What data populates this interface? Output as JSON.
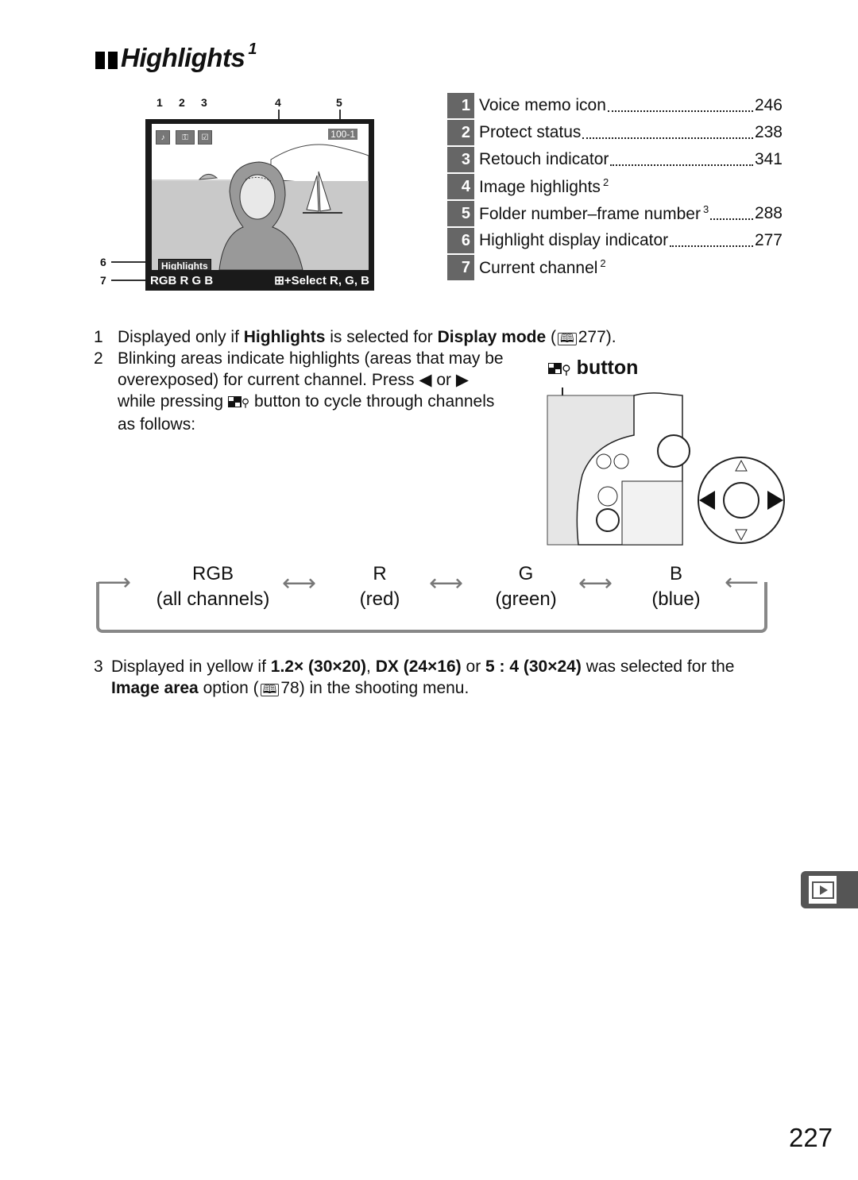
{
  "title": {
    "text": "Highlights",
    "superscript": "1"
  },
  "screen": {
    "callouts": [
      "1",
      "2",
      "3",
      "4",
      "5",
      "6",
      "7"
    ],
    "folder_frame": "100-1",
    "highlight_label": "Highlights",
    "channel_readout": "RGB R G B",
    "hint": "+Select R, G, B"
  },
  "legend": [
    {
      "num": "1",
      "label": "Voice memo icon",
      "sup": "",
      "page": "246"
    },
    {
      "num": "2",
      "label": "Protect status",
      "sup": "",
      "page": "238"
    },
    {
      "num": "3",
      "label": "Retouch indicator",
      "sup": "",
      "page": "341"
    },
    {
      "num": "4",
      "label": "Image highlights",
      "sup": "2",
      "page": ""
    },
    {
      "num": "5",
      "label": "Folder number–frame number",
      "sup": "3",
      "page": "288"
    },
    {
      "num": "6",
      "label": "Highlight display indicator",
      "sup": "",
      "page": "277"
    },
    {
      "num": "7",
      "label": "Current channel",
      "sup": "2",
      "page": ""
    }
  ],
  "notes": {
    "n1": {
      "num": "1",
      "pre": "Displayed only if ",
      "b1": "Highlights",
      "mid": " is selected for ",
      "b2": "Display mode",
      "ref": "(",
      "page": "277",
      "post": ")."
    },
    "n2": {
      "num": "2",
      "line1": "Blinking areas indicate highlights (areas that may be",
      "line2": "overexposed) for current channel.  Press ◀ or ▶",
      "line3a": "while pressing ",
      "line3b": " button to cycle through channels",
      "line4": "as follows:"
    },
    "n3": {
      "num": "3",
      "pre": "Displayed in yellow if ",
      "b1": "1.2× (30×20)",
      "sep1": ", ",
      "b2": "DX (24×16)",
      "sep2": " or ",
      "b3": "5 : 4 (30×24)",
      "post": " was selected for the",
      "b4": "Image area",
      "post2": " option (",
      "page": "78",
      "post3": ") in the shooting menu."
    }
  },
  "button_caption": "button",
  "cycle": [
    {
      "name": "RGB",
      "desc": "(all channels)"
    },
    {
      "name": "R",
      "desc": "(red)"
    },
    {
      "name": "G",
      "desc": "(green)"
    },
    {
      "name": "B",
      "desc": "(blue)"
    }
  ],
  "page_number": "227",
  "side_tab_icon": "playback-icon"
}
